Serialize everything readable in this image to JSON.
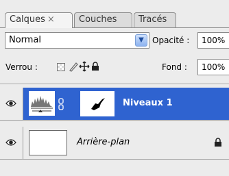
{
  "tabs": [
    {
      "label": "Calques",
      "close": "×"
    },
    {
      "label": "Couches"
    },
    {
      "label": "Tracés"
    }
  ],
  "blend": {
    "mode": "Normal",
    "opacity_label": "Opacité :",
    "opacity_value": "100%"
  },
  "lock": {
    "label": "Verrou :",
    "fill_label": "Fond :",
    "fill_value": "100%"
  },
  "layers": [
    {
      "name": "Niveaux 1",
      "selected": true
    },
    {
      "name": "Arrière-plan",
      "locked": true
    }
  ],
  "colors": {
    "selection": "#2f63d0",
    "panel": "#ececec"
  }
}
